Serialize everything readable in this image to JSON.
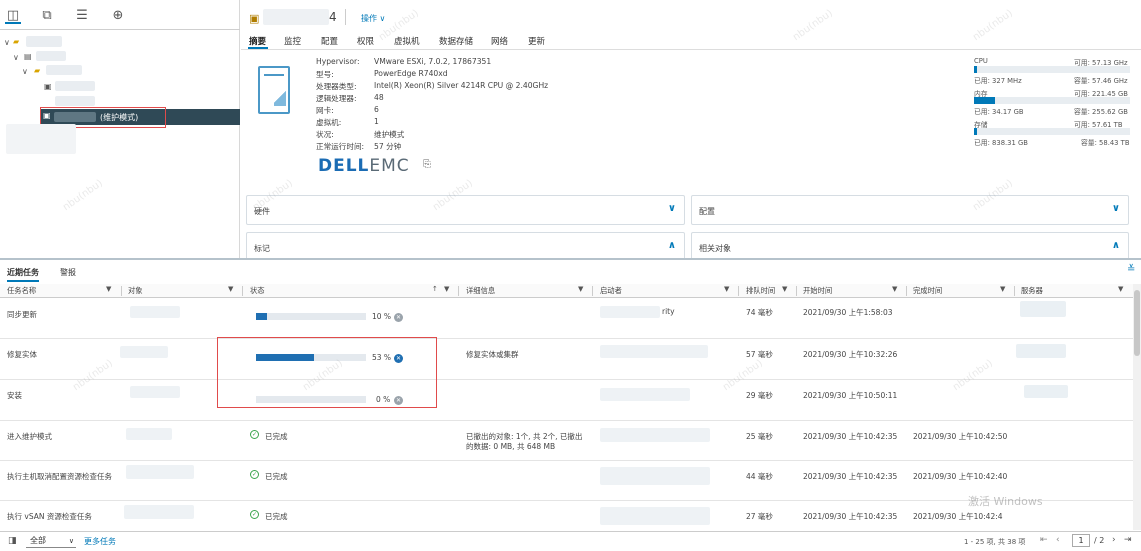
{
  "nav": {
    "tree_suffix": "(维护模式)"
  },
  "header": {
    "host_suffix": "4",
    "actions": "操作 ∨"
  },
  "tabs": [
    "摘要",
    "监控",
    "配置",
    "权限",
    "虚拟机",
    "数据存储",
    "网络",
    "更新"
  ],
  "summary": {
    "labels": [
      "Hypervisor:",
      "型号:",
      "处理器类型:",
      "逻辑处理器:",
      "网卡:",
      "虚拟机:",
      "状况:",
      "正常运行时间:"
    ],
    "values": [
      "VMware ESXi, 7.0.2, 17867351",
      "PowerEdge R740xd",
      "Intel(R) Xeon(R) Silver 4214R CPU @ 2.40GHz",
      "48",
      "6",
      "1",
      "维护模式",
      "57 分钟"
    ],
    "logo": "D&LLEMC"
  },
  "resources": [
    {
      "name": "CPU",
      "free": "可用: 57.13 GHz",
      "used": "已用: 327 MHz",
      "capacity": "容量: 57.46 GHz",
      "used_fraction": 0.006
    },
    {
      "name": "内存",
      "free": "可用: 221.45 GB",
      "used": "已用: 34.17 GB",
      "capacity": "容量: 255.62 GB",
      "used_fraction": 0.134
    },
    {
      "name": "存储",
      "free": "可用: 57.61 TB",
      "used": "已用: 838.31 GB",
      "capacity": "容量: 58.43 TB",
      "used_fraction": 0.014
    }
  ],
  "cards": {
    "hardware": "硬件",
    "config": "配置",
    "tags": "标记",
    "related": "相关对象"
  },
  "bottom_tabs": {
    "recent": "近期任务",
    "alarms": "警报"
  },
  "columns": [
    "任务名称",
    "对象",
    "状态",
    "详细信息",
    "启动者",
    "排队时间",
    "开始时间",
    "完成时间",
    "服务器"
  ],
  "tasks": [
    {
      "name": "同步更新",
      "status_pct": "10 %",
      "progress": 0.1,
      "details": "",
      "initiator_tail": "rity",
      "queue": "74 毫秒",
      "start": "2021/09/30 上午1:58:03",
      "finish": ""
    },
    {
      "name": "修复实体",
      "status_pct": "53 %",
      "progress": 0.53,
      "details": "修复实体或集群",
      "initiator_tail": "",
      "queue": "57 毫秒",
      "start": "2021/09/30 上午10:32:26",
      "finish": ""
    },
    {
      "name": "安装",
      "status_pct": "0 %",
      "progress": 0.0,
      "details": "",
      "initiator_tail": "",
      "queue": "29 毫秒",
      "start": "2021/09/30 上午10:50:11",
      "finish": ""
    },
    {
      "name": "进入维护模式",
      "status_done": "已完成",
      "details": "已撤出的对象: 1个, 共 2个, 已撤出",
      "details2": "的数据: 0 MB, 共 648 MB",
      "queue": "25 毫秒",
      "start": "2021/09/30 上午10:42:35",
      "finish": "2021/09/30 上午10:42:50"
    },
    {
      "name": "执行主机取消配置资源检查任务",
      "status_done": "已完成",
      "details": "",
      "queue": "44 毫秒",
      "start": "2021/09/30 上午10:42:35",
      "finish": "2021/09/30 上午10:42:40"
    },
    {
      "name": "执行 vSAN 资源检查任务",
      "status_done": "已完成",
      "details": "",
      "queue": "27 毫秒",
      "start": "2021/09/30 上午10:42:35",
      "finish": "2021/09/30 上午10:42:4"
    }
  ],
  "footer": {
    "filter": "全部",
    "more": "更多任务",
    "count": "1 - 25 项, 共 38 项",
    "page": "1",
    "pages": "/ 2"
  },
  "watermark": "nbu(nbu)",
  "activate": "激活 Windows",
  "colors": {
    "accent": "#0079b8",
    "selected_row": "#2f4956",
    "progress": "#1f6fb2",
    "ok": "#3aa54d",
    "highlight": "#e04b4b"
  }
}
